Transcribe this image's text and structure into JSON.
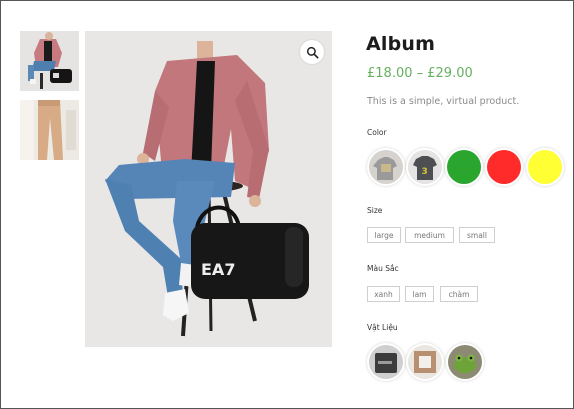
{
  "product": {
    "title": "Album",
    "price": "£18.00 – £29.00",
    "short_description": "This is a simple, virtual product."
  },
  "gallery": {
    "thumbnails": [
      "thumb-seated-man-with-bag",
      "thumb-beige-trousers"
    ],
    "zoom_icon": "magnifier-icon"
  },
  "attributes": {
    "color": {
      "label": "Color",
      "swatches": [
        {
          "type": "image",
          "name": "grey-tshirt-image"
        },
        {
          "type": "image",
          "name": "dark-tshirt-image"
        },
        {
          "type": "color",
          "color": "#2aa62e"
        },
        {
          "type": "color",
          "color": "#ff2b2b"
        },
        {
          "type": "color",
          "color": "#ffff33"
        }
      ]
    },
    "size": {
      "label": "Size",
      "options": [
        "large",
        "medium",
        "small"
      ]
    },
    "mau_sac": {
      "label": "Màu Sắc",
      "options": [
        "xanh",
        "lam",
        "chàm"
      ]
    },
    "vat_lieu": {
      "label": "Vật Liệu",
      "swatches": [
        "dark-fabric-image",
        "brown-fabric-image",
        "frog-image"
      ]
    }
  }
}
